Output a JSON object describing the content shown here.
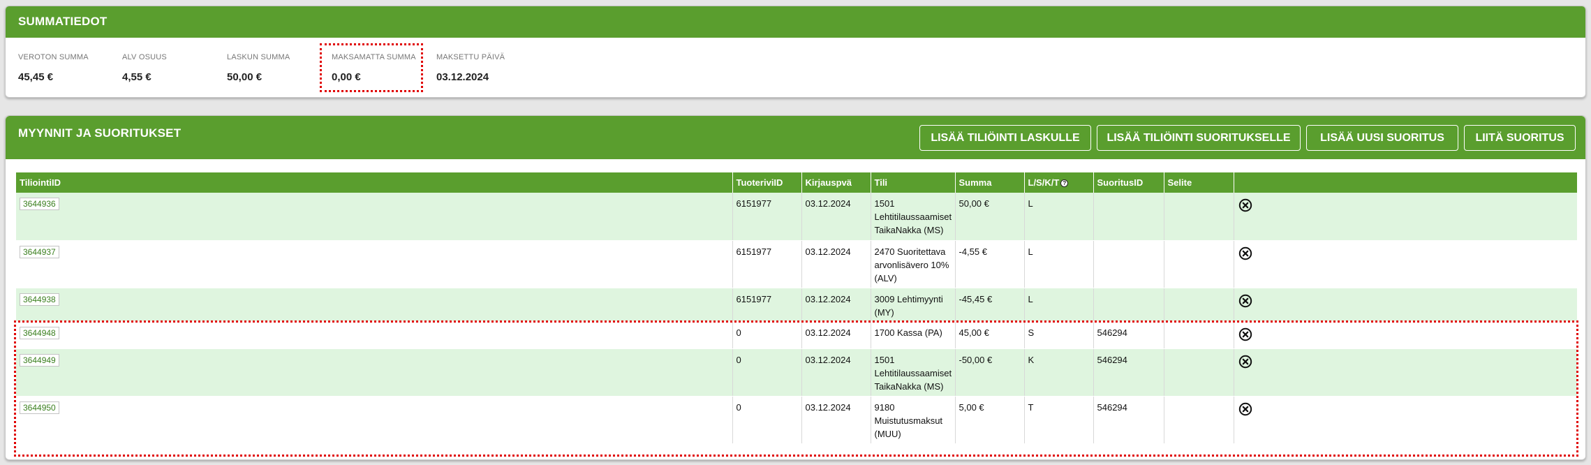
{
  "summary": {
    "title": "SUMMATIEDOT",
    "items": [
      {
        "label": "VEROTON SUMMA",
        "value": "45,45 €"
      },
      {
        "label": "ALV OSUUS",
        "value": "4,55 €"
      },
      {
        "label": "LASKUN SUMMA",
        "value": "50,00 €"
      },
      {
        "label": "MAKSAMATTA SUMMA",
        "value": "0,00 €"
      },
      {
        "label": "MAKSETTU PÄIVÄ",
        "value": "03.12.2024"
      }
    ]
  },
  "sales": {
    "title": "MYYNNIT JA SUORITUKSET",
    "buttons": {
      "add_invoice_entry": "LISÄÄ TILIÖINTI LASKULLE",
      "add_payment_entry": "LISÄÄ TILIÖINTI SUORITUKSELLE",
      "add_new_payment": "LISÄÄ UUSI SUORITUS",
      "attach_payment": "LIITÄ SUORITUS"
    },
    "columns": {
      "id": "TiliointiID",
      "line": "TuoteriviID",
      "date": "Kirjauspvä",
      "account": "Tili",
      "sum": "Summa",
      "type": "L/S/K/T",
      "payment": "SuoritusID",
      "note": "Selite"
    },
    "rows": [
      {
        "id": "3644936",
        "line": "6151977",
        "date": "03.12.2024",
        "account": "1501 Lehtitilaussaamiset TaikaNakka (MS)",
        "sum": "50,00 €",
        "type": "L",
        "payment": "",
        "note": ""
      },
      {
        "id": "3644937",
        "line": "6151977",
        "date": "03.12.2024",
        "account": "2470 Suoritettava arvonlisävero 10% (ALV)",
        "sum": "-4,55 €",
        "type": "L",
        "payment": "",
        "note": ""
      },
      {
        "id": "3644938",
        "line": "6151977",
        "date": "03.12.2024",
        "account": "3009 Lehtimyynti (MY)",
        "sum": "-45,45 €",
        "type": "L",
        "payment": "",
        "note": ""
      },
      {
        "id": "3644948",
        "line": "0",
        "date": "03.12.2024",
        "account": "1700 Kassa (PA)",
        "sum": "45,00 €",
        "type": "S",
        "payment": "546294",
        "note": ""
      },
      {
        "id": "3644949",
        "line": "0",
        "date": "03.12.2024",
        "account": "1501 Lehtitilaussaamiset TaikaNakka (MS)",
        "sum": "-50,00 €",
        "type": "K",
        "payment": "546294",
        "note": ""
      },
      {
        "id": "3644950",
        "line": "0",
        "date": "03.12.2024",
        "account": "9180 Muistutusmaksut (MUU)",
        "sum": "5,00 €",
        "type": "T",
        "payment": "546294",
        "note": ""
      }
    ]
  },
  "icons": {
    "delete": "close-circle-icon",
    "help": "question-circle-icon"
  },
  "colors": {
    "header_green": "#5a9e2e",
    "row_green": "#dff5df",
    "highlight_red": "#e00000"
  }
}
